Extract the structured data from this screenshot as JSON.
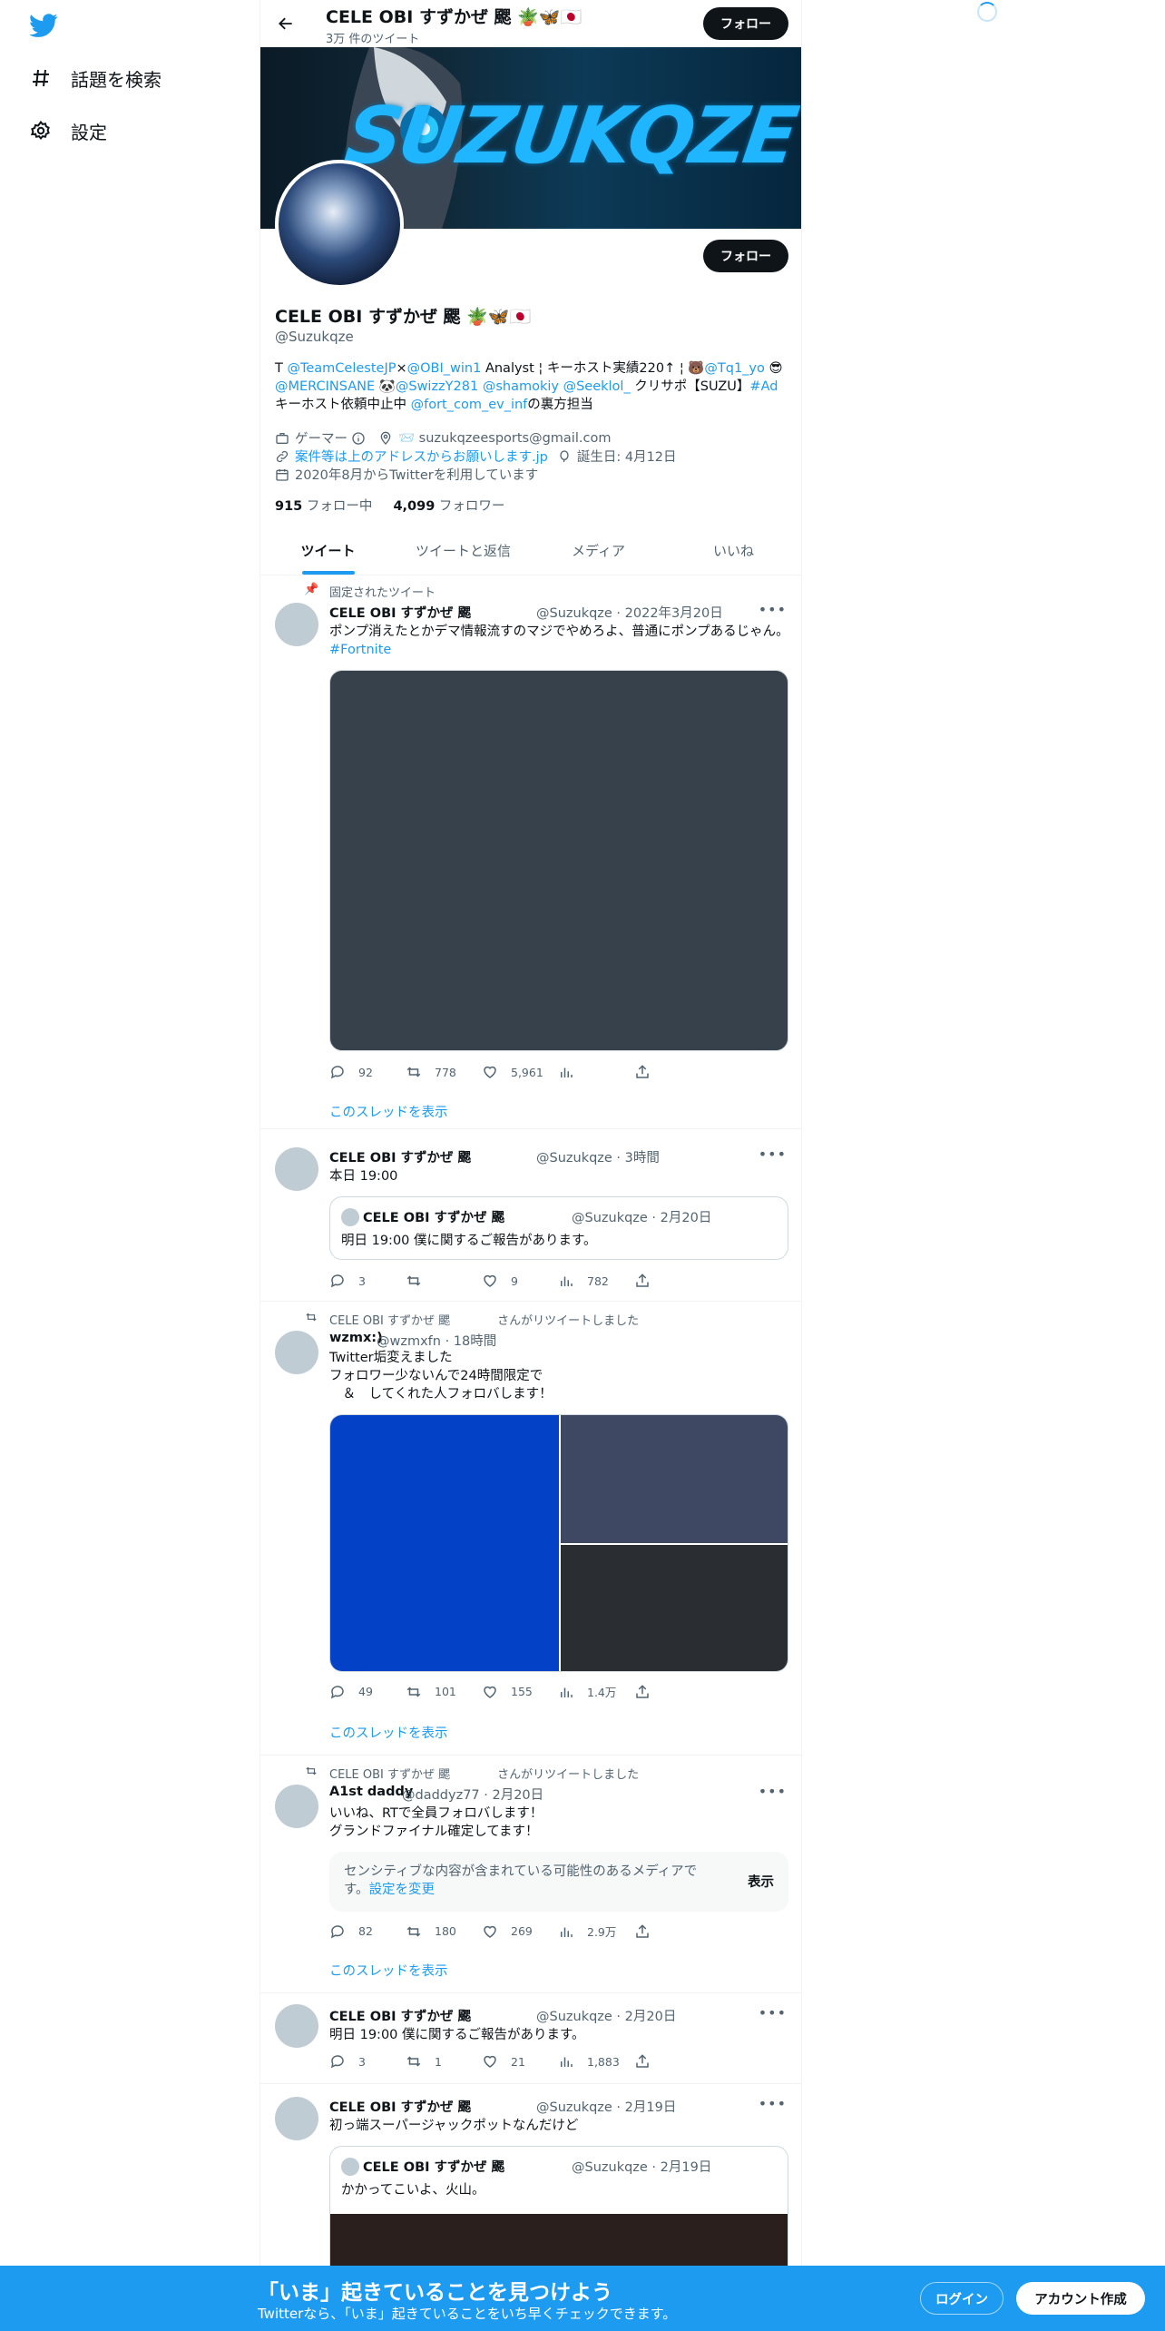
{
  "sidebar": {
    "items": [
      {
        "label": "話題を検索",
        "icon": "hashtag-icon"
      },
      {
        "label": "設定",
        "icon": "gear-icon"
      }
    ]
  },
  "topbar": {
    "name": "CELE OBI すずかぜ 颸 🪴🦋🇯🇵",
    "tweet_count": "3万 件のツイート",
    "follow_label": "フォロー"
  },
  "banner": {
    "text": "SUZUKQZE"
  },
  "profile": {
    "follow_label": "フォロー",
    "name": "CELE OBI すずかぜ 颸 🪴🦋🇯🇵",
    "handle": "@Suzukqze",
    "bio": {
      "p1": "T ",
      "l1": "@TeamCelesteJP",
      "p2": "×",
      "l2": "@OBI_win1",
      "p3": " Analyst ¦ キーホスト実績220↑ ¦ 🐻",
      "l3": "@Tq1_yo",
      "p4": " 😎",
      "l4": "@MERCINSANE",
      "p5": " 🐼",
      "l5": "@SwizzY281",
      "p6": " ",
      "l6": "@shamokiy",
      "p7": " ",
      "l7": "@Seeklol_",
      "p8": " クリサポ【SUZU】",
      "l8": "#Ad",
      "p9": " キーホスト依頼中止中 ",
      "l9": "@fort_com_ev_inf",
      "p10": "の裏方担当"
    },
    "category": "ゲーマー",
    "email": "📨 suzukqzeesports@gmail.com",
    "website": "案件等は上のアドレスからお願いします.jp",
    "birthday": "誕生日: 4月12日",
    "joined": "2020年8月からTwitterを利用しています",
    "following_count": "915",
    "following_label": "フォロー中",
    "followers_count": "4,099",
    "followers_label": "フォロワー"
  },
  "tabs": [
    "ツイート",
    "ツイートと返信",
    "メディア",
    "いいね"
  ],
  "tweets": {
    "t1": {
      "pinned_label": "固定されたツイート",
      "name": "CELE OBI すずかぜ 颸",
      "handle_time": "@Suzukqze · 2022年3月20日",
      "text": "ポンプ消えたとかデマ情報流すのマジでやめろよ、普通にポンプあるじゃん。",
      "hashtag": "#Fortnite",
      "replies": "92",
      "retweets": "778",
      "likes": "5,961",
      "thread_link": "このスレッドを表示"
    },
    "t2": {
      "name": "CELE OBI すずかぜ 颸",
      "handle_time": "@Suzukqze · 3時間",
      "text": "本日 19:00",
      "quote": {
        "name": "CELE OBI すずかぜ 颸",
        "handle_time": "@Suzukqze · 2月20日",
        "text": "明日 19:00 僕に関するご報告があります。"
      },
      "replies": "3",
      "likes": "9",
      "views": "782"
    },
    "t3": {
      "social": "CELE OBI すずかぜ 颸　　　　さんがリツイートしました",
      "name": "wzmx:)",
      "handle_time": "@wzmxfn · 18時間",
      "text": "Twitter垢変えました\nフォロワー少ないんで24時間限定で\n　＆　してくれた人フォロバします！",
      "replies": "49",
      "retweets": "101",
      "likes": "155",
      "views": "1.4万",
      "thread_link": "このスレッドを表示"
    },
    "t4": {
      "social": "CELE OBI すずかぜ 颸　　　　さんがリツイートしました",
      "name": "A1st daddy",
      "handle_time": "@daddyz77 · 2月20日",
      "text": "いいね、RTで全員フォロバします！\nグランドファイナル確定してます！",
      "sensitive_text": "センシティブな内容が含まれている可能性のあるメディアです。",
      "sensitive_link": "設定を変更",
      "sensitive_button": "表示",
      "replies": "82",
      "retweets": "180",
      "likes": "269",
      "views": "2.9万",
      "thread_link": "このスレッドを表示"
    },
    "t5": {
      "name": "CELE OBI すずかぜ 颸",
      "handle_time": "@Suzukqze · 2月20日",
      "text": "明日 19:00 僕に関するご報告があります。",
      "replies": "3",
      "retweets": "1",
      "likes": "21",
      "views": "1,883"
    },
    "t6": {
      "name": "CELE OBI すずかぜ 颸",
      "handle_time": "@Suzukqze · 2月19日",
      "text": "初っ端スーパージャックポットなんだけど",
      "quote": {
        "name": "CELE OBI すずかぜ 颸",
        "handle_time": "@Suzukqze · 2月19日",
        "text": "かかってこいよ、火山。"
      }
    }
  },
  "bottom": {
    "title": "「いま」起きていることを見つけよう",
    "subtitle": "Twitterなら、「いま」起きていることをいち早くチェックできます。",
    "login": "ログイン",
    "signup": "アカウント作成"
  },
  "colors": {
    "accent": "#1d9bf0",
    "text": "#0f1419",
    "muted": "#536471"
  }
}
